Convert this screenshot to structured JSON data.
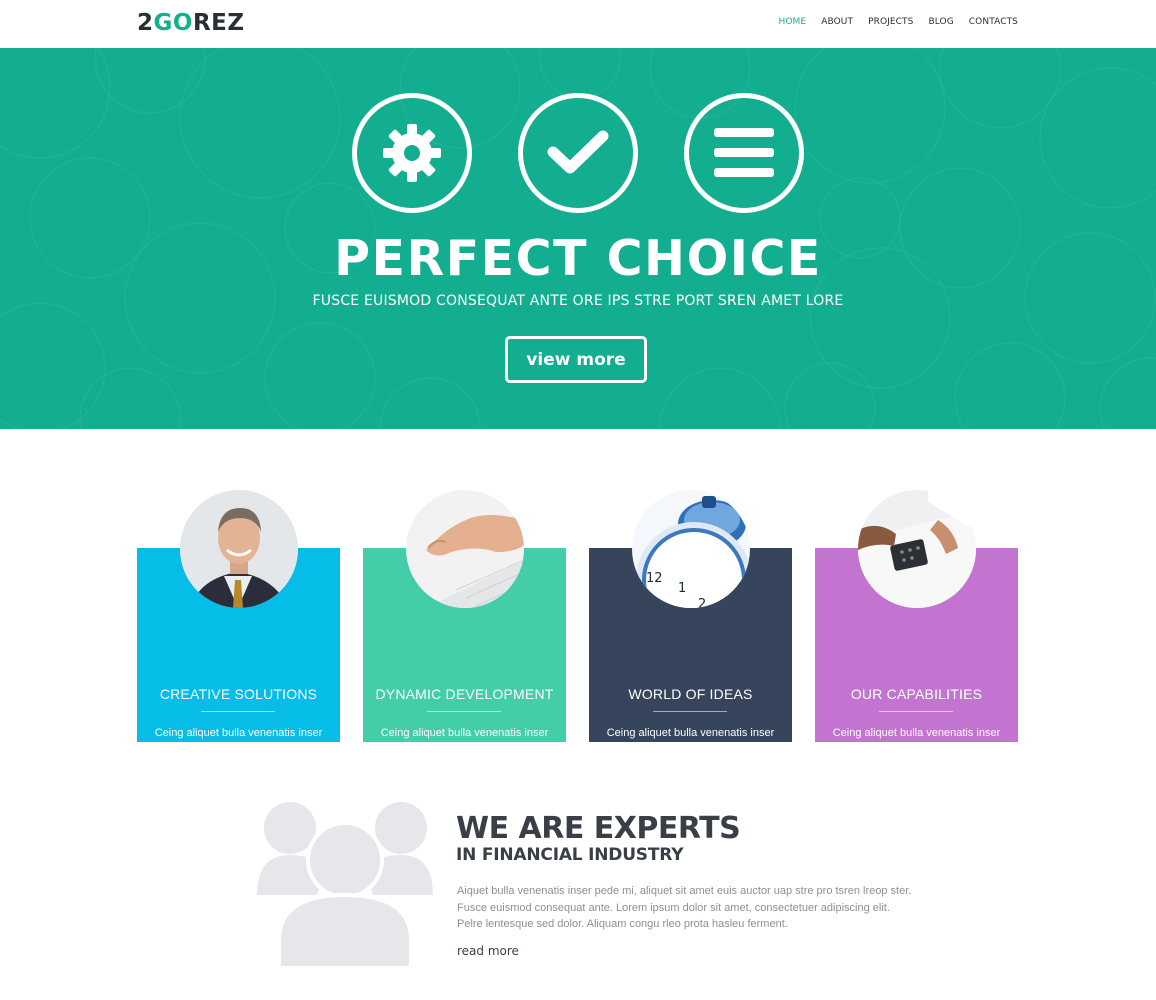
{
  "header": {
    "logo": {
      "part1": "2",
      "part2": "GO",
      "part3": "REZ"
    },
    "nav": [
      {
        "label": "HOME",
        "active": true
      },
      {
        "label": "ABOUT"
      },
      {
        "label": "PROJECTS"
      },
      {
        "label": "BLOG"
      },
      {
        "label": "CONTACTS"
      }
    ]
  },
  "hero": {
    "icons": [
      "gear-icon",
      "check-icon",
      "menu-icon"
    ],
    "title": "PERFECT CHOICE",
    "subtitle": "FUSCE EUISMOD CONSEQUAT ANTE ORE IPS STRE PORT SREN AMET LORE",
    "button_label": "view more",
    "background_color": "#13ad90"
  },
  "cards": [
    {
      "title": "CREATIVE SOLUTIONS",
      "text": "Ceing aliquet bulla venenatis inser pede mi, aliquet sit amet euis auctor ut am dap sere.",
      "color": "#05bde6",
      "image": "businessman-photo"
    },
    {
      "title": "DYNAMIC DEVELOPMENT",
      "text": "Ceing aliquet bulla venenatis inser pede mi, aliquet sit amet euis auctor ut am dap sere.",
      "color": "#43cda8",
      "image": "hand-keyboard-photo"
    },
    {
      "title": "WORLD OF IDEAS",
      "text": "Ceing aliquet bulla venenatis inser pede mi, aliquet sit amet euis auctor ut am dap ser.",
      "color": "#36455c",
      "image": "alarm-clock-photo"
    },
    {
      "title": "OUR CAPABILITIES",
      "text": "Ceing aliquet bulla venenatis inser pede mi, aliquet sit amet euis auctor ut am dap sere.",
      "color": "#c374d1",
      "image": "calculator-hands-photo"
    }
  ],
  "experts": {
    "icon": "people-group-icon",
    "title": "WE ARE EXPERTS",
    "subtitle": "IN FINANCIAL INDUSTRY",
    "text": "Aiquet bulla venenatis inser  pede mi, aliquet sit amet euis auctor uap stre pro tsren lreop ster. Fusce euismod consequat ante. Lorem ipsum dolor sit amet, consectetuer adipiscing elit. Pelre lentesque sed dolor. Aliquam congu rleo prota hasleu ferment.",
    "link_label": "read more"
  }
}
